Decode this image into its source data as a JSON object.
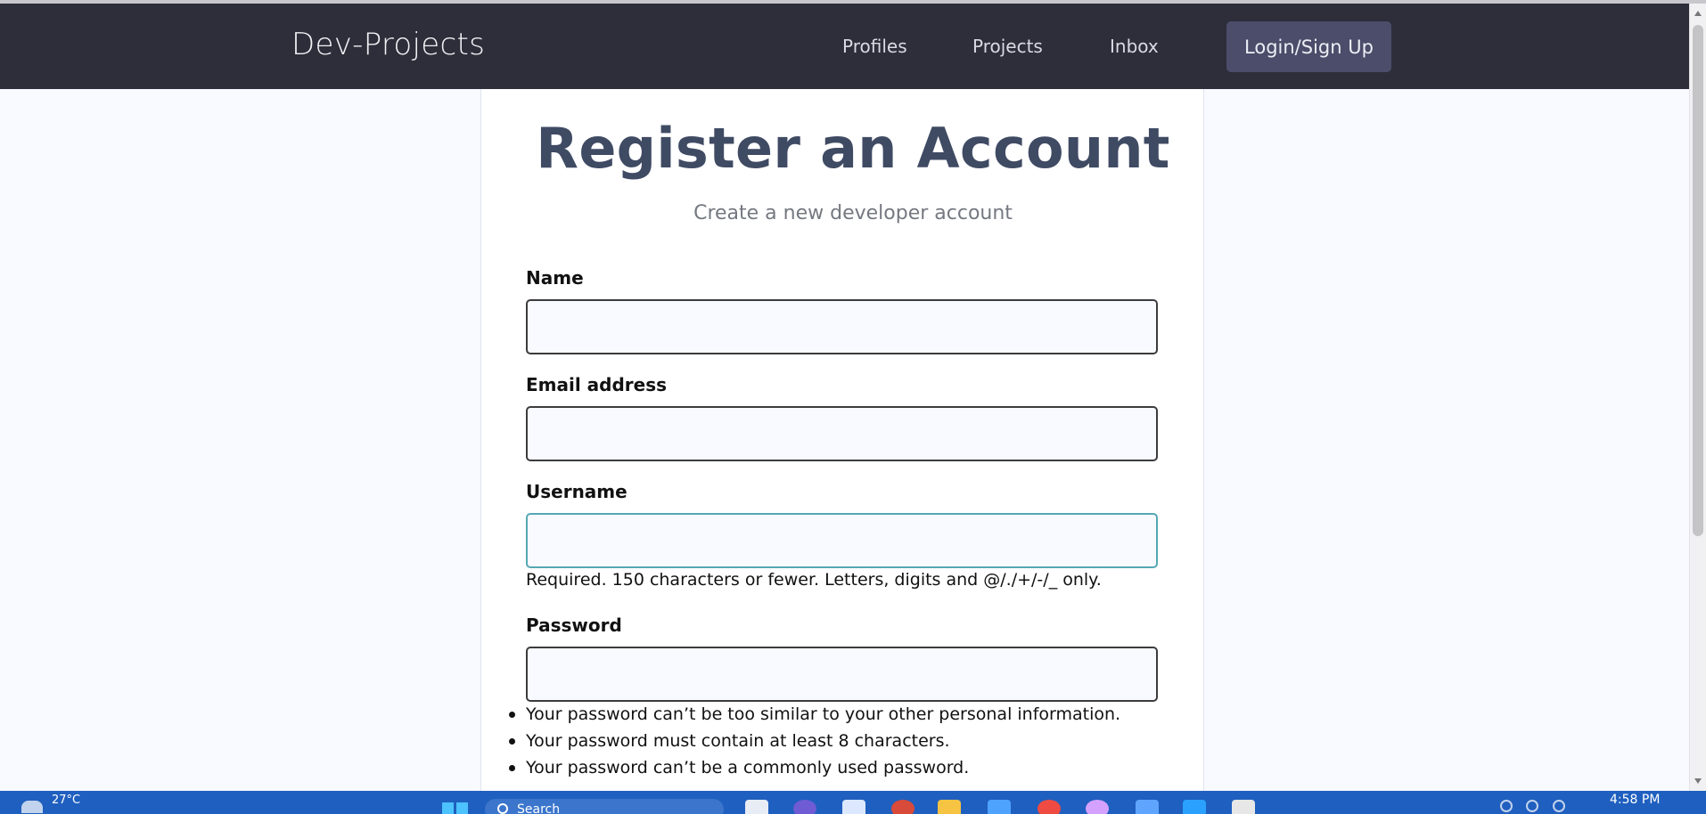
{
  "navbar": {
    "brand": "Dev-Projects",
    "links": [
      "Profiles",
      "Projects",
      "Inbox"
    ],
    "login_label": "Login/Sign Up"
  },
  "page": {
    "title": "Register an Account",
    "subtitle": "Create a new developer account"
  },
  "form": {
    "name_label": "Name",
    "email_label": "Email address",
    "username_label": "Username",
    "username_help": "Required. 150 characters or fewer. Letters, digits and @/./+/-/_ only.",
    "password_label": "Password",
    "password_rules": [
      "Your password can’t be too similar to your other personal information.",
      "Your password must contain at least 8 characters.",
      "Your password can’t be a commonly used password."
    ]
  },
  "taskbar": {
    "temperature": "27°C",
    "search_placeholder": "Search",
    "time": "4:58 PM",
    "apps": [
      "file-explorer-icon",
      "chat-icon",
      "mail-icon",
      "chrome-icon",
      "folder-icon",
      "store-icon",
      "chrome-profile-icon",
      "chrome-profile-icon",
      "app-icon",
      "vscode-icon",
      "notepad-icon"
    ],
    "colors": {
      "taskbar": "#1f5fbf",
      "accent": "#4cc2ff"
    }
  },
  "colors": {
    "navbar": "#2d2e3a",
    "login_button": "#4b4d6a",
    "title": "#3f4a63",
    "focused_border": "#55a8b4"
  }
}
